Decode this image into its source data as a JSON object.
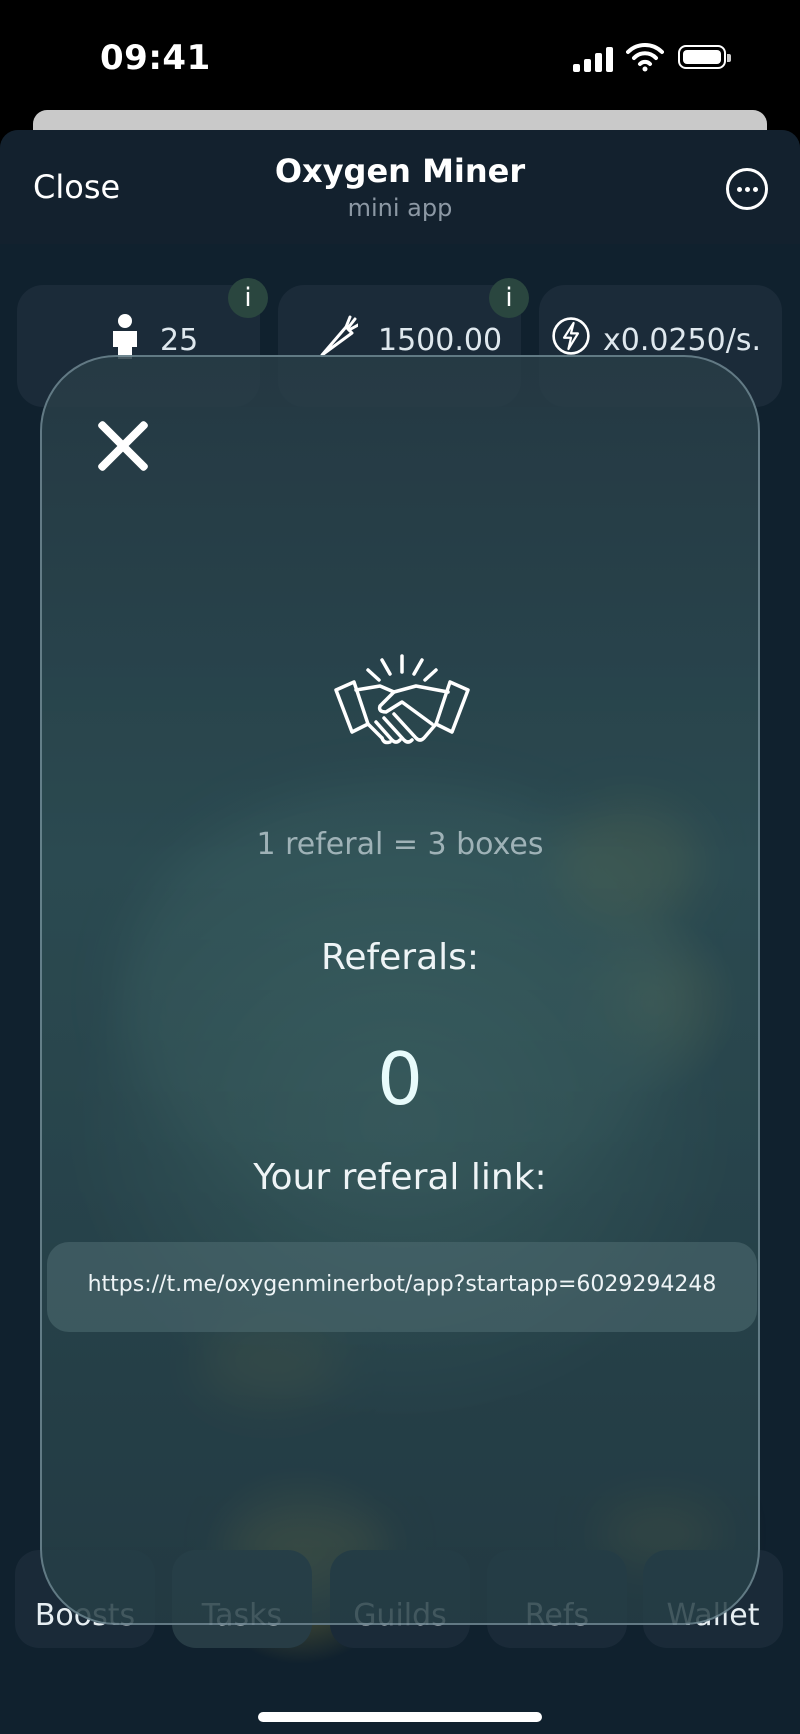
{
  "status_bar": {
    "time": "09:41"
  },
  "header": {
    "close_label": "Close",
    "title": "Oxygen Miner",
    "subtitle": "mini app"
  },
  "stats": [
    {
      "icon": "person-icon",
      "value": "25"
    },
    {
      "icon": "carrot-icon",
      "value": "1500.00"
    },
    {
      "icon": "lightning-icon",
      "value": "x0.0250/s."
    }
  ],
  "info_badge": "i",
  "nav": [
    {
      "label": "Boosts"
    },
    {
      "label": "Tasks",
      "active": true
    },
    {
      "label": "Guilds"
    },
    {
      "label": "Refs"
    },
    {
      "label": "Wallet"
    }
  ],
  "modal": {
    "ratio_text": "1 referal = 3 boxes",
    "referals_label": "Referals:",
    "referals_count": "0",
    "link_label": "Your referal link:",
    "link": "https://t.me/oxygenminerbot/app?startapp=6029294248"
  },
  "colors": {
    "background": "#0e1c28",
    "accent": "#2a463f"
  }
}
